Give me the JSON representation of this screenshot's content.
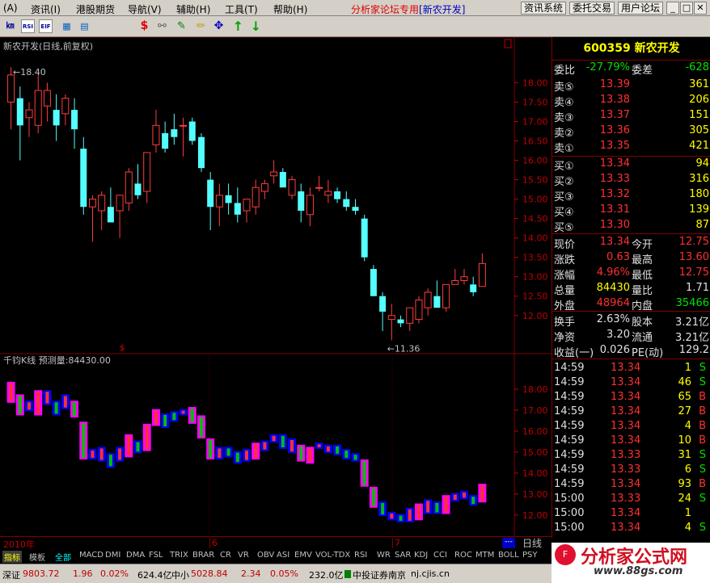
{
  "menu": {
    "items": [
      "(A)",
      "资讯(I)",
      "港股期货",
      "导航(V)",
      "辅助(H)",
      "工具(T)",
      "帮助(H)"
    ],
    "center_title": "分析家论坛专用",
    "center_stock": "[新农开发]",
    "right_buttons": [
      "资讯系统",
      "委托交易",
      "用户论坛"
    ],
    "win_buttons": [
      "_",
      "□",
      "✕"
    ]
  },
  "toolbar": {
    "icons": [
      "chart-icon",
      "rsi-icon",
      "etf-icon",
      "grid-icon",
      "table-icon",
      "dollar-icon",
      "link-icon",
      "pen-icon",
      "move-icon",
      "up-arrow-icon",
      "down-arrow-icon"
    ],
    "glyphs": [
      "㎞",
      "RSI",
      "EIF",
      "▦",
      "▤",
      "$",
      "⚯",
      "✎",
      "✥",
      "↑",
      "↓"
    ]
  },
  "chart": {
    "title": "新农开发(日线,前复权)",
    "high_label": "←18.40",
    "low_label": "←11.36",
    "indicator_title": "千钧K线 预测量:84430.00"
  },
  "chart_data": [
    {
      "type": "candlestick",
      "title": "新农开发(日线,前复权)",
      "y_ticks": [
        18.0,
        17.5,
        17.0,
        16.5,
        16.0,
        15.5,
        15.0,
        14.5,
        14.0,
        13.5,
        13.0,
        12.5,
        12.0
      ],
      "ylim": [
        11.1,
        18.8
      ],
      "candles": [
        {
          "o": 17.5,
          "h": 18.4,
          "l": 16.8,
          "c": 18.2
        },
        {
          "o": 17.6,
          "h": 17.9,
          "l": 16.0,
          "c": 16.9
        },
        {
          "o": 17.1,
          "h": 17.5,
          "l": 16.6,
          "c": 17.3
        },
        {
          "o": 16.9,
          "h": 18.2,
          "l": 16.7,
          "c": 17.8
        },
        {
          "o": 17.4,
          "h": 18.0,
          "l": 17.0,
          "c": 17.8
        },
        {
          "o": 17.3,
          "h": 17.7,
          "l": 16.5,
          "c": 16.9
        },
        {
          "o": 17.2,
          "h": 17.7,
          "l": 16.9,
          "c": 17.6
        },
        {
          "o": 17.3,
          "h": 17.6,
          "l": 16.3,
          "c": 16.8
        },
        {
          "o": 16.3,
          "h": 16.6,
          "l": 14.6,
          "c": 14.8
        },
        {
          "o": 14.8,
          "h": 15.1,
          "l": 13.9,
          "c": 15.0
        },
        {
          "o": 14.7,
          "h": 15.2,
          "l": 14.2,
          "c": 15.1
        },
        {
          "o": 14.8,
          "h": 15.3,
          "l": 14.5,
          "c": 14.4
        },
        {
          "o": 14.7,
          "h": 14.9,
          "l": 14.0,
          "c": 15.1
        },
        {
          "o": 14.9,
          "h": 15.8,
          "l": 14.7,
          "c": 15.7
        },
        {
          "o": 15.4,
          "h": 15.9,
          "l": 15.0,
          "c": 15.1
        },
        {
          "o": 15.2,
          "h": 16.1,
          "l": 14.9,
          "c": 16.2
        },
        {
          "o": 16.4,
          "h": 17.3,
          "l": 16.2,
          "c": 16.9
        },
        {
          "o": 16.7,
          "h": 17.0,
          "l": 16.2,
          "c": 16.3
        },
        {
          "o": 16.8,
          "h": 17.2,
          "l": 16.4,
          "c": 16.6
        },
        {
          "o": 16.9,
          "h": 17.1,
          "l": 16.1,
          "c": 16.9
        },
        {
          "o": 17.0,
          "h": 17.1,
          "l": 16.4,
          "c": 16.5
        },
        {
          "o": 16.6,
          "h": 16.7,
          "l": 15.7,
          "c": 15.8
        },
        {
          "o": 15.5,
          "h": 15.7,
          "l": 14.2,
          "c": 14.8
        },
        {
          "o": 14.8,
          "h": 15.4,
          "l": 14.3,
          "c": 15.1
        },
        {
          "o": 15.1,
          "h": 15.4,
          "l": 14.6,
          "c": 14.9
        },
        {
          "o": 14.9,
          "h": 15.3,
          "l": 14.4,
          "c": 14.6
        },
        {
          "o": 14.7,
          "h": 15.0,
          "l": 14.4,
          "c": 15.0
        },
        {
          "o": 14.8,
          "h": 15.5,
          "l": 14.6,
          "c": 15.3
        },
        {
          "o": 15.2,
          "h": 15.5,
          "l": 15.0,
          "c": 15.4
        },
        {
          "o": 15.6,
          "h": 16.0,
          "l": 15.4,
          "c": 15.7
        },
        {
          "o": 15.7,
          "h": 15.8,
          "l": 15.4,
          "c": 15.3
        },
        {
          "o": 15.1,
          "h": 15.6,
          "l": 15.0,
          "c": 15.5
        },
        {
          "o": 15.2,
          "h": 15.4,
          "l": 14.4,
          "c": 14.7
        },
        {
          "o": 14.6,
          "h": 15.3,
          "l": 14.3,
          "c": 15.1
        },
        {
          "o": 15.3,
          "h": 15.6,
          "l": 15.2,
          "c": 15.3
        },
        {
          "o": 15.1,
          "h": 15.5,
          "l": 14.9,
          "c": 15.2
        },
        {
          "o": 15.2,
          "h": 15.3,
          "l": 14.9,
          "c": 15.0
        },
        {
          "o": 15.0,
          "h": 15.2,
          "l": 14.7,
          "c": 14.8
        },
        {
          "o": 14.8,
          "h": 15.0,
          "l": 14.6,
          "c": 14.7
        },
        {
          "o": 14.5,
          "h": 14.6,
          "l": 13.4,
          "c": 13.5
        },
        {
          "o": 13.2,
          "h": 13.3,
          "l": 12.5,
          "c": 12.5
        },
        {
          "o": 12.5,
          "h": 12.6,
          "l": 11.6,
          "c": 12.1
        },
        {
          "o": 11.9,
          "h": 12.3,
          "l": 11.36,
          "c": 12.0
        },
        {
          "o": 11.9,
          "h": 12.0,
          "l": 11.7,
          "c": 11.8
        },
        {
          "o": 11.8,
          "h": 12.2,
          "l": 11.6,
          "c": 12.2
        },
        {
          "o": 11.9,
          "h": 12.5,
          "l": 11.8,
          "c": 12.4
        },
        {
          "o": 12.2,
          "h": 12.7,
          "l": 12.0,
          "c": 12.6
        },
        {
          "o": 12.5,
          "h": 12.9,
          "l": 12.3,
          "c": 12.2
        },
        {
          "o": 12.2,
          "h": 12.8,
          "l": 12.1,
          "c": 12.8
        },
        {
          "o": 12.8,
          "h": 13.2,
          "l": 12.8,
          "c": 12.9
        },
        {
          "o": 12.9,
          "h": 13.2,
          "l": 12.8,
          "c": 13.0
        },
        {
          "o": 12.8,
          "h": 13.0,
          "l": 12.5,
          "c": 12.6
        },
        {
          "o": 12.75,
          "h": 13.6,
          "l": 12.75,
          "c": 13.34
        }
      ]
    },
    {
      "type": "bar",
      "title": "千钧K线 预测量:84430.00",
      "y_ticks": [
        18.0,
        17.0,
        16.0,
        15.0,
        14.0,
        13.0,
        12.0
      ],
      "ylim": [
        11.3,
        19.0
      ],
      "colors": {
        "up": "#ff3030",
        "down": "#00c000",
        "strong": "#ff00ff",
        "weak": "#0000ff"
      }
    }
  ],
  "quote": {
    "code": "600359",
    "name": "新农开发",
    "rows": [
      {
        "l": "委比",
        "v": "-27.79%",
        "l2": "委差",
        "v2": "-628",
        "c": "#00e000",
        "c2": "#00e000"
      },
      {
        "l": "卖⑤",
        "v": "13.39",
        "v2": "361",
        "c": "#ff3030",
        "c2": "#ffff00"
      },
      {
        "l": "卖④",
        "v": "13.38",
        "v2": "206",
        "c": "#ff3030",
        "c2": "#ffff00"
      },
      {
        "l": "卖③",
        "v": "13.37",
        "v2": "151",
        "c": "#ff3030",
        "c2": "#ffff00"
      },
      {
        "l": "卖②",
        "v": "13.36",
        "v2": "305",
        "c": "#ff3030",
        "c2": "#ffff00"
      },
      {
        "l": "卖①",
        "v": "13.35",
        "v2": "421",
        "c": "#ff3030",
        "c2": "#ffff00"
      },
      {
        "l": "买①",
        "v": "13.34",
        "v2": "94",
        "c": "#ff3030",
        "c2": "#ffff00"
      },
      {
        "l": "买②",
        "v": "13.33",
        "v2": "316",
        "c": "#ff3030",
        "c2": "#ffff00"
      },
      {
        "l": "买③",
        "v": "13.32",
        "v2": "180",
        "c": "#ff3030",
        "c2": "#ffff00"
      },
      {
        "l": "买④",
        "v": "13.31",
        "v2": "139",
        "c": "#ff3030",
        "c2": "#ffff00"
      },
      {
        "l": "买⑤",
        "v": "13.30",
        "v2": "87",
        "c": "#ff3030",
        "c2": "#ffff00"
      },
      {
        "l": "现价",
        "v": "13.34",
        "l2": "今开",
        "v2": "12.75",
        "c": "#ff3030",
        "c2": "#ff3030"
      },
      {
        "l": "涨跌",
        "v": "0.63",
        "l2": "最高",
        "v2": "13.60",
        "c": "#ff3030",
        "c2": "#ff3030"
      },
      {
        "l": "涨幅",
        "v": "4.96%",
        "l2": "最低",
        "v2": "12.75",
        "c": "#ff3030",
        "c2": "#ff3030"
      },
      {
        "l": "总量",
        "v": "84430",
        "l2": "量比",
        "v2": "1.71",
        "c": "#ffff00",
        "c2": "#e0e0e0"
      },
      {
        "l": "外盘",
        "v": "48964",
        "l2": "内盘",
        "v2": "35466",
        "c": "#ff3030",
        "c2": "#00e000"
      },
      {
        "l": "换手",
        "v": "2.63%",
        "l2": "股本",
        "v2": "3.21亿",
        "c": "#e0e0e0",
        "c2": "#e0e0e0"
      },
      {
        "l": "净资",
        "v": "3.20",
        "l2": "流通",
        "v2": "3.21亿",
        "c": "#e0e0e0",
        "c2": "#e0e0e0"
      },
      {
        "l": "收益(一)",
        "v": "0.026",
        "l2": "PE(动)",
        "v2": "129.2",
        "c": "#e0e0e0",
        "c2": "#e0e0e0"
      }
    ]
  },
  "ticks": [
    {
      "t": "14:59",
      "p": "13.34",
      "v": "1",
      "bs": "S"
    },
    {
      "t": "14:59",
      "p": "13.34",
      "v": "46",
      "bs": "S"
    },
    {
      "t": "14:59",
      "p": "13.34",
      "v": "65",
      "bs": "B"
    },
    {
      "t": "14:59",
      "p": "13.34",
      "v": "27",
      "bs": "B"
    },
    {
      "t": "14:59",
      "p": "13.34",
      "v": "4",
      "bs": "B"
    },
    {
      "t": "14:59",
      "p": "13.34",
      "v": "10",
      "bs": "B"
    },
    {
      "t": "14:59",
      "p": "13.33",
      "v": "31",
      "bs": "S"
    },
    {
      "t": "14:59",
      "p": "13.33",
      "v": "6",
      "bs": "S"
    },
    {
      "t": "14:59",
      "p": "13.34",
      "v": "93",
      "bs": "B"
    },
    {
      "t": "15:00",
      "p": "13.33",
      "v": "24",
      "bs": "S"
    },
    {
      "t": "15:00",
      "p": "13.34",
      "v": "1",
      "bs": ""
    },
    {
      "t": "15:00",
      "p": "13.34",
      "v": "4",
      "bs": "S"
    }
  ],
  "date_axis": {
    "year": "2010年",
    "m6": "6",
    "m7": "7",
    "period": "日线"
  },
  "tabs": [
    "指标",
    "模板",
    "全部",
    "MACD",
    "DMI",
    "DMA",
    "FSL",
    "TRIX",
    "BRAR",
    "CR",
    "VR",
    "OBV",
    "ASI",
    "EMV",
    "VOL-TDX",
    "RSI",
    "WR",
    "SAR",
    "KDJ",
    "CCI",
    "ROC",
    "MTM",
    "BOLL",
    "PSY"
  ],
  "status": {
    "sh_label": "深证",
    "sh_val": "9803.72",
    "sh_chg": "1.96",
    "sh_pct": "0.02%",
    "sh_amt": "624.4亿",
    "sz_label": "中小",
    "sz_val": "5028.84",
    "sz_chg": "2.34",
    "sz_pct": "0.05%",
    "sz_amt": "232.0亿",
    "broker": "中投证券南京",
    "url": "nj.cjis.cn"
  },
  "logo": {
    "text": "分析家公式网",
    "url": "www.88gs.com"
  }
}
